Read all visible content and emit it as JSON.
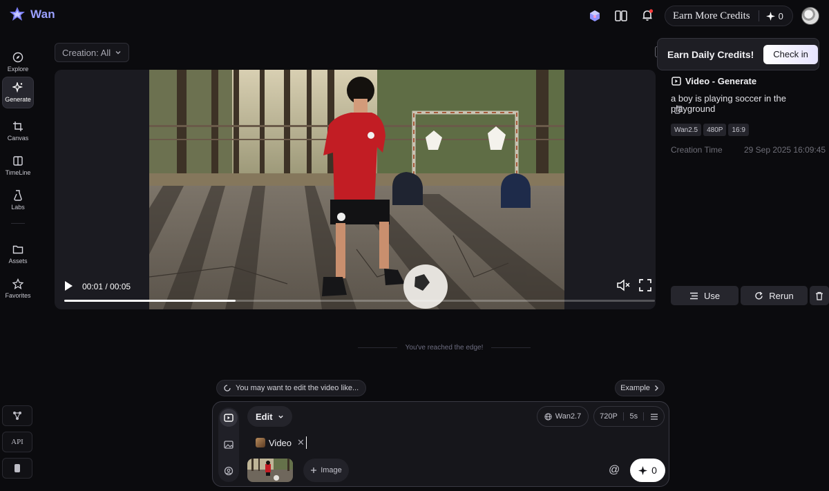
{
  "app": {
    "name": "Wan"
  },
  "header": {
    "earn_label": "Earn More Credits",
    "credits": "0"
  },
  "sidebar": {
    "items": [
      {
        "label": "Explore",
        "icon": "compass-icon"
      },
      {
        "label": "Generate",
        "icon": "sparkle-icon"
      },
      {
        "label": "Canvas",
        "icon": "crop-icon"
      },
      {
        "label": "TimeLine",
        "icon": "timeline-icon"
      },
      {
        "label": "Labs",
        "icon": "flask-icon"
      },
      {
        "label": "Assets",
        "icon": "folder-icon"
      },
      {
        "label": "Favorites",
        "icon": "star-icon"
      }
    ],
    "bottom": {
      "api_label": "API"
    }
  },
  "filter": {
    "label": "Creation: All"
  },
  "video": {
    "time": "00:01 / 00:05",
    "progress": 0.29
  },
  "tooltip": {
    "title": "Earn Daily Credits!",
    "button": "Check in"
  },
  "details": {
    "type": "Video - Generate",
    "prompt": "a boy is playing soccer in the playground",
    "tags": [
      "Wan2.5",
      "480P",
      "16:9"
    ],
    "creation_label": "Creation Time",
    "creation_value": "29 Sep 2025 16:09:45",
    "use_label": "Use",
    "rerun_label": "Rerun"
  },
  "feed": {
    "edge_text": "You've reached the edge!"
  },
  "suggestion": {
    "text": "You may want to edit the video like...",
    "example_label": "Example"
  },
  "composer": {
    "mode_label": "Edit",
    "model": "Wan2.7",
    "resolution": "720P",
    "duration": "5s",
    "chip_label": "Video",
    "add_image_label": "Image",
    "at": "@",
    "cost": "0"
  },
  "colors": {
    "accent": "#9aa0ff",
    "notification": "#ff3b3b",
    "background": "#0b0b0e"
  }
}
